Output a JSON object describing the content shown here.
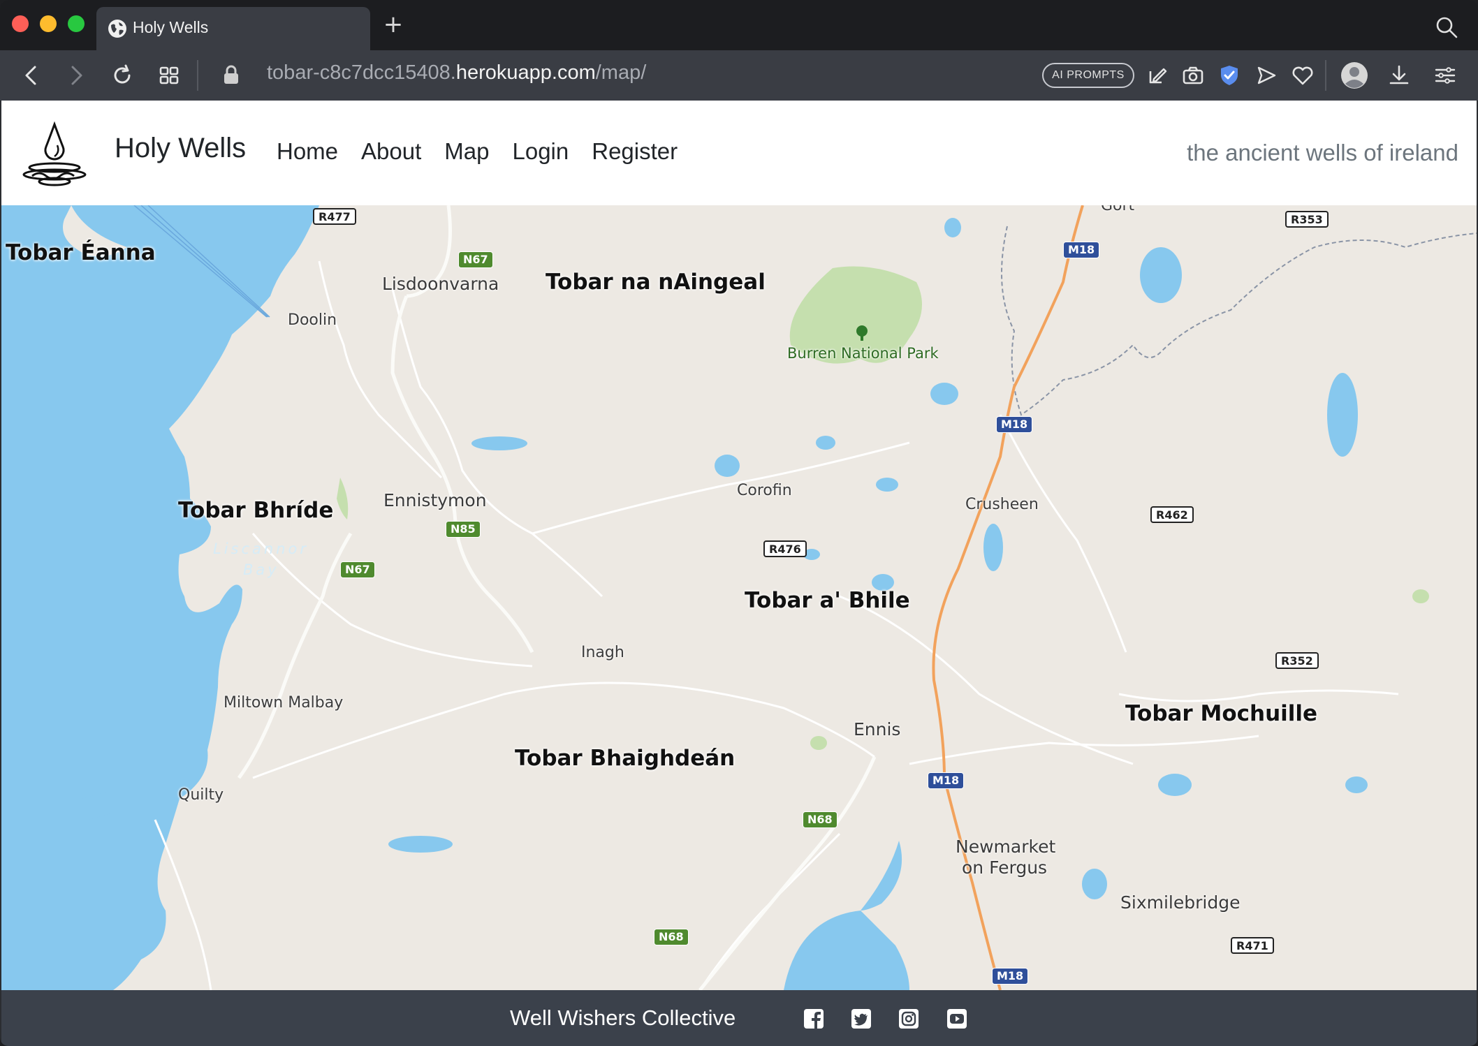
{
  "browser": {
    "tab_title": "Holy Wells",
    "url_host_prefix": "tobar-c8c7dcc15408.",
    "url_host_domain": "herokuapp.com",
    "url_path": "/map/",
    "ai_prompts_label": "AI PROMPTS"
  },
  "site": {
    "title": "Holy Wells",
    "nav": [
      "Home",
      "About",
      "Map",
      "Login",
      "Register"
    ],
    "tagline": "the ancient wells of ireland"
  },
  "map": {
    "wells": [
      "Tobar Éanna",
      "Tobar na nAingeal",
      "Tobar Bhríde",
      "Tobar a' Bhile",
      "Tobar Mochuille",
      "Tobar Bhaighdeán"
    ],
    "towns": [
      "Lisdoonvarna",
      "Doolin",
      "Ennistymon",
      "Corofin",
      "Crusheen",
      "Inagh",
      "Miltown Malbay",
      "Quilty",
      "Ennis",
      "Newmarket",
      "on Fergus",
      "Sixmilebridge",
      "Gort"
    ],
    "park": "Burren National Park",
    "bay": [
      "Liscannor",
      "Bay"
    ],
    "roads": {
      "r477": "R477",
      "n67a": "N67",
      "n67b": "N67",
      "r353": "R353",
      "m18a": "M18",
      "m18b": "M18",
      "m18c": "M18",
      "m18d": "M18",
      "n85": "N85",
      "r476": "R476",
      "r462": "R462",
      "r352": "R352",
      "n68a": "N68",
      "n68b": "N68",
      "r471": "R471"
    }
  },
  "footer": {
    "title": "Well Wishers Collective",
    "social": [
      "facebook-icon",
      "twitter-icon",
      "instagram-icon",
      "youtube-icon"
    ]
  }
}
